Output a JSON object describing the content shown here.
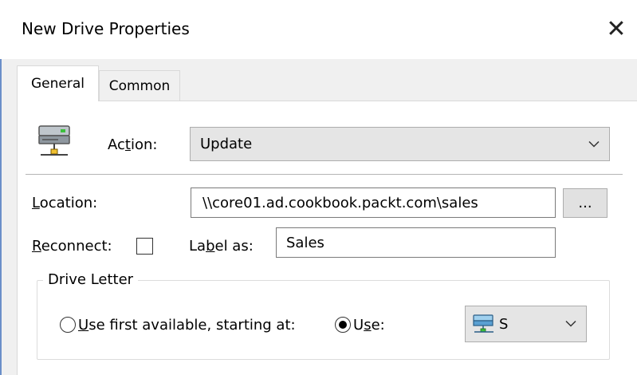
{
  "window": {
    "title": "New Drive Properties",
    "close_symbol": "✕"
  },
  "tabs": [
    {
      "label": "General",
      "selected": true
    },
    {
      "label": "Common",
      "selected": false
    }
  ],
  "action": {
    "label_pre": "Ac",
    "label_accel": "t",
    "label_post": "ion:",
    "value": "Update",
    "icon": "network-drive-icon"
  },
  "location": {
    "label_accel": "L",
    "label_post": "ocation:",
    "value": "\\\\core01.ad.cookbook.packt.com\\sales",
    "browse_label": "..."
  },
  "reconnect": {
    "label_accel": "R",
    "label_post": "econnect:",
    "checked": false
  },
  "label_as": {
    "label_pre": "La",
    "label_accel": "b",
    "label_post": "el as:",
    "value": "Sales"
  },
  "drive_letter": {
    "group_label": "Drive Letter",
    "option_first": {
      "label_accel": "U",
      "label_post": "se first available, starting at:",
      "checked": false
    },
    "option_use": {
      "label_pre": "U",
      "label_accel": "s",
      "label_post": "e:",
      "checked": true
    },
    "letter_value": "S",
    "letter_icon": "network-drive-icon"
  },
  "colors": {
    "window_border": "#6b8fc9",
    "field_border": "#7a7a7a",
    "combo_bg": "#e5e5e5"
  }
}
